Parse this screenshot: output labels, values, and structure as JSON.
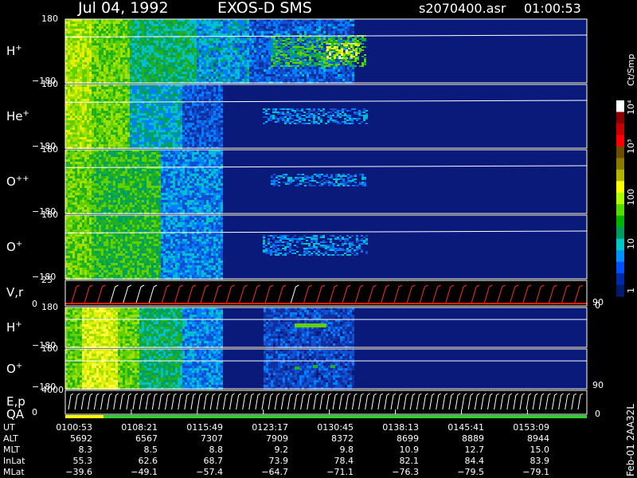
{
  "header": {
    "date": "Jul 04, 1992",
    "instrument": "EXOS-D SMS",
    "file": "s2070400.asr",
    "time": "01:00:53"
  },
  "colorbar": {
    "unit": "Ct/Smp",
    "tick_labels": [
      "10⁴",
      "10³",
      "100",
      "10",
      "1"
    ],
    "colors": [
      "#ffffff",
      "#8a0000",
      "#c40000",
      "#ff0000",
      "#6b4e00",
      "#8a7a00",
      "#b4b400",
      "#ffff00",
      "#aaff00",
      "#55dd00",
      "#00b400",
      "#009a60",
      "#00c8c8",
      "#0090ff",
      "#0050ff",
      "#002aaa",
      "#001a6e"
    ]
  },
  "panels": [
    {
      "name": "h-plus-pitch",
      "label": "H",
      "sup": "+",
      "ymax": "180",
      "ymin": "−180"
    },
    {
      "name": "he-plus-pitch",
      "label": "He",
      "sup": "+",
      "ymax": "180",
      "ymin": "−180"
    },
    {
      "name": "o-plus-plus-pitch",
      "label": "O",
      "sup": "++",
      "ymax": "180",
      "ymin": "−180"
    },
    {
      "name": "o-plus-pitch",
      "label": "O",
      "sup": "+",
      "ymax": "180",
      "ymin": "−180"
    },
    {
      "name": "v-r",
      "label": "V,r",
      "sup": "",
      "ymax": "25",
      "ymin": "0",
      "right_top": "90",
      "right_bottom": "0"
    },
    {
      "name": "h-plus-energy",
      "label": "H",
      "sup": "+",
      "ymax": "180",
      "ymin": "−180"
    },
    {
      "name": "o-plus-energy",
      "label": "O",
      "sup": "+",
      "ymax": "180",
      "ymin": "−180",
      "right_top": "90"
    },
    {
      "name": "e-p-qa",
      "label": "E,p",
      "label2": "QA",
      "sup": "",
      "ymax": "4000",
      "ymin": "0",
      "right_bottom": "0"
    }
  ],
  "side_label": "Feb-01 2AA32L",
  "table": {
    "rows": [
      {
        "label": "UT",
        "values": [
          "0100:53",
          "0108:21",
          "0115:49",
          "0123:17",
          "0130:45",
          "0138:13",
          "0145:41",
          "0153:09"
        ]
      },
      {
        "label": "ALT",
        "values": [
          "5692",
          "6567",
          "7307",
          "7909",
          "8372",
          "8699",
          "8889",
          "8944"
        ]
      },
      {
        "label": "MLT",
        "values": [
          "8.3",
          "8.5",
          "8.8",
          "9.2",
          "9.8",
          "10.9",
          "12.7",
          "15.0"
        ]
      },
      {
        "label": "InLat",
        "values": [
          "55.3",
          "62.6",
          "68.7",
          "73.9",
          "78.4",
          "82.1",
          "84.4",
          "83.9"
        ]
      },
      {
        "label": "MLat",
        "values": [
          "−39.6",
          "−49.1",
          "−57.4",
          "−64.7",
          "−71.1",
          "−76.3",
          "−79.5",
          "−79.1"
        ]
      }
    ]
  },
  "chart_data": {
    "type": "heatmap",
    "title": "Jul 04, 1992   EXOS-D SMS",
    "xlabel": "UT",
    "x_ticks": [
      "0100:53",
      "0108:21",
      "0115:49",
      "0123:17",
      "0130:45",
      "0138:13",
      "0145:41",
      "0153:09"
    ],
    "colorbar_label": "Ct/Smp",
    "colorbar_range": [
      1,
      10000
    ],
    "colorbar_scale": "log",
    "series": [
      {
        "name": "H+",
        "ylim": [
          -180,
          180
        ]
      },
      {
        "name": "He+",
        "ylim": [
          -180,
          180
        ]
      },
      {
        "name": "O++",
        "ylim": [
          -180,
          180
        ]
      },
      {
        "name": "O+",
        "ylim": [
          -180,
          180
        ]
      },
      {
        "name": "V,r",
        "ylim": [
          0,
          25
        ]
      },
      {
        "name": "H+",
        "ylim": [
          -180,
          180
        ]
      },
      {
        "name": "O+",
        "ylim": [
          -180,
          180
        ]
      },
      {
        "name": "E,p / QA",
        "ylim": [
          0,
          4000
        ]
      }
    ]
  }
}
